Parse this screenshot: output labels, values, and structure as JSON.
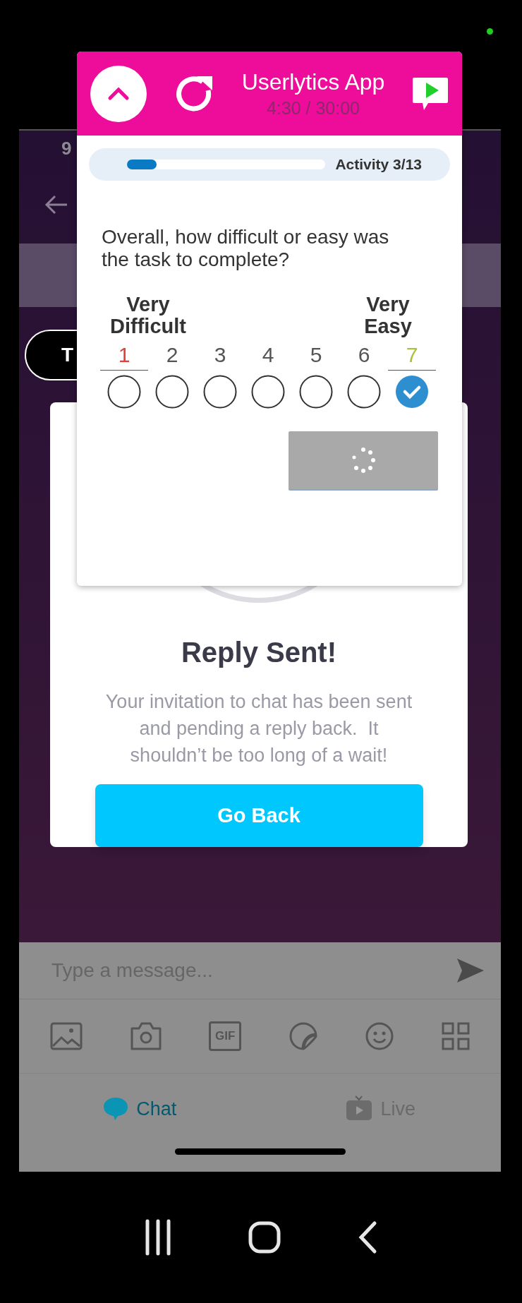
{
  "background_app": {
    "status_time": "9",
    "pill_label": "T",
    "modal": {
      "title": "Reply Sent!",
      "message": "Your invitation to chat has been sent and pending a reply back.  It shouldn’t be too long of a wait!",
      "button": "Go Back"
    },
    "composer": {
      "placeholder": "Type a message..."
    },
    "toolbar": [
      {
        "kind": "image"
      },
      {
        "kind": "camera"
      },
      {
        "kind": "gif",
        "label": "GIF"
      },
      {
        "kind": "sticker"
      },
      {
        "kind": "emoji"
      },
      {
        "kind": "apps"
      }
    ],
    "tabs": [
      {
        "label": "Chat",
        "selected": true
      },
      {
        "label": "Live",
        "selected": false
      }
    ]
  },
  "overlay": {
    "title": "Userlytics App",
    "timer": "4:30 / 30:00",
    "progress": {
      "level": 0.15,
      "label": "Activity 3/13"
    },
    "question": "Overall, how difficult or easy was the task to complete?",
    "scale_labels": [
      "Very Difficult",
      "Very Easy"
    ],
    "options": [
      {
        "number": "1",
        "selected": false,
        "anchor": true,
        "color": "#e0403a"
      },
      {
        "number": "2",
        "selected": false,
        "anchor": false,
        "color": "#555555"
      },
      {
        "number": "3",
        "selected": false,
        "anchor": false,
        "color": "#555555"
      },
      {
        "number": "4",
        "selected": false,
        "anchor": false,
        "color": "#555555"
      },
      {
        "number": "5",
        "selected": false,
        "anchor": false,
        "color": "#555555"
      },
      {
        "number": "6",
        "selected": false,
        "anchor": false,
        "color": "#555555"
      },
      {
        "number": "7",
        "selected": true,
        "anchor": true,
        "color": "#a8c23a"
      }
    ],
    "submit": {
      "loading": true
    }
  }
}
